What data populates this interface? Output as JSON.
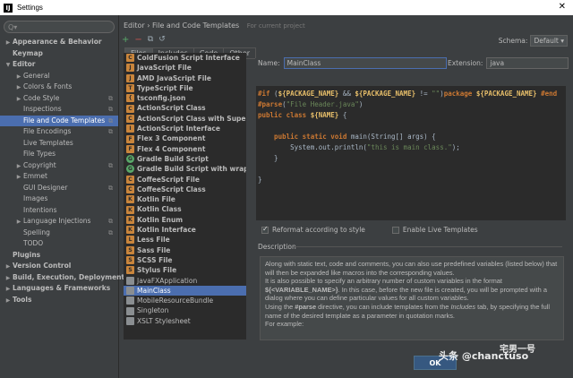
{
  "window": {
    "title": "Settings",
    "app_icon": "intellij-icon",
    "close_glyph": "✕"
  },
  "search": {
    "placeholder": "Q▾"
  },
  "tree": [
    {
      "label": "Appearance & Behavior",
      "bold": true,
      "arrow": "▶",
      "indent": 0
    },
    {
      "label": "Keymap",
      "bold": true,
      "arrow": "",
      "indent": 0
    },
    {
      "label": "Editor",
      "bold": true,
      "arrow": "▼",
      "indent": 0
    },
    {
      "label": "General",
      "bold": false,
      "arrow": "▶",
      "indent": 1
    },
    {
      "label": "Colors & Fonts",
      "bold": false,
      "arrow": "▶",
      "indent": 1
    },
    {
      "label": "Code Style",
      "bold": false,
      "arrow": "▶",
      "indent": 1,
      "cfg": true
    },
    {
      "label": "Inspections",
      "bold": false,
      "arrow": "",
      "indent": 1,
      "cfg": true
    },
    {
      "label": "File and Code Templates",
      "bold": false,
      "arrow": "",
      "indent": 1,
      "cfg": true,
      "selected": true
    },
    {
      "label": "File Encodings",
      "bold": false,
      "arrow": "",
      "indent": 1,
      "cfg": true
    },
    {
      "label": "Live Templates",
      "bold": false,
      "arrow": "",
      "indent": 1
    },
    {
      "label": "File Types",
      "bold": false,
      "arrow": "",
      "indent": 1
    },
    {
      "label": "Copyright",
      "bold": false,
      "arrow": "▶",
      "indent": 1,
      "cfg": true
    },
    {
      "label": "Emmet",
      "bold": false,
      "arrow": "▶",
      "indent": 1
    },
    {
      "label": "GUI Designer",
      "bold": false,
      "arrow": "",
      "indent": 1,
      "cfg": true
    },
    {
      "label": "Images",
      "bold": false,
      "arrow": "",
      "indent": 1
    },
    {
      "label": "Intentions",
      "bold": false,
      "arrow": "",
      "indent": 1
    },
    {
      "label": "Language Injections",
      "bold": false,
      "arrow": "▶",
      "indent": 1,
      "cfg": true
    },
    {
      "label": "Spelling",
      "bold": false,
      "arrow": "",
      "indent": 1,
      "cfg": true
    },
    {
      "label": "TODO",
      "bold": false,
      "arrow": "",
      "indent": 1
    },
    {
      "label": "Plugins",
      "bold": true,
      "arrow": "",
      "indent": 0
    },
    {
      "label": "Version Control",
      "bold": true,
      "arrow": "▶",
      "indent": 0
    },
    {
      "label": "Build, Execution, Deployment",
      "bold": true,
      "arrow": "▶",
      "indent": 0
    },
    {
      "label": "Languages & Frameworks",
      "bold": true,
      "arrow": "▶",
      "indent": 0
    },
    {
      "label": "Tools",
      "bold": true,
      "arrow": "▶",
      "indent": 0
    }
  ],
  "breadcrumb": {
    "section": "Editor",
    "sep": "›",
    "page": "File and Code Templates",
    "note": "For current project"
  },
  "toolbar": {
    "add": "+",
    "remove": "−",
    "copy": "⧉",
    "reset": "↺"
  },
  "schema": {
    "label": "Schema:",
    "value": "Default",
    "chevron": "▾"
  },
  "tabs": [
    {
      "label": "Files",
      "active": true
    },
    {
      "label": "Includes",
      "active": false
    },
    {
      "label": "Code",
      "active": false
    },
    {
      "label": "Other",
      "active": false
    }
  ],
  "files": [
    {
      "label": "ColdFusion Script Interface",
      "bold": true,
      "icon": "orange",
      "glyph": "C"
    },
    {
      "label": "JavaScript File",
      "bold": true,
      "icon": "orange",
      "glyph": "J"
    },
    {
      "label": "AMD JavaScript File",
      "bold": true,
      "icon": "orange",
      "glyph": "J"
    },
    {
      "label": "TypeScript File",
      "bold": true,
      "icon": "orange",
      "glyph": "T"
    },
    {
      "label": "tsconfig.json",
      "bold": true,
      "icon": "orange",
      "glyph": "{"
    },
    {
      "label": "ActionScript Class",
      "bold": true,
      "icon": "orange",
      "glyph": "C"
    },
    {
      "label": "ActionScript Class with Supers",
      "bold": true,
      "icon": "orange",
      "glyph": "C"
    },
    {
      "label": "ActionScript Interface",
      "bold": true,
      "icon": "orange",
      "glyph": "I"
    },
    {
      "label": "Flex 3 Component",
      "bold": true,
      "icon": "orange",
      "glyph": "F"
    },
    {
      "label": "Flex 4 Component",
      "bold": true,
      "icon": "orange",
      "glyph": "F"
    },
    {
      "label": "Gradle Build Script",
      "bold": true,
      "icon": "green",
      "glyph": "G"
    },
    {
      "label": "Gradle Build Script with wrapper",
      "bold": true,
      "icon": "green",
      "glyph": "G"
    },
    {
      "label": "CoffeeScript File",
      "bold": true,
      "icon": "orange",
      "glyph": "C"
    },
    {
      "label": "CoffeeScript Class",
      "bold": true,
      "icon": "orange",
      "glyph": "C"
    },
    {
      "label": "Kotlin File",
      "bold": true,
      "icon": "orange",
      "glyph": "K"
    },
    {
      "label": "Kotlin Class",
      "bold": true,
      "icon": "orange",
      "glyph": "K"
    },
    {
      "label": "Kotlin Enum",
      "bold": true,
      "icon": "orange",
      "glyph": "K"
    },
    {
      "label": "Kotlin Interface",
      "bold": true,
      "icon": "orange",
      "glyph": "K"
    },
    {
      "label": "Less File",
      "bold": true,
      "icon": "orange",
      "glyph": "L"
    },
    {
      "label": "Sass File",
      "bold": true,
      "icon": "orange",
      "glyph": "S"
    },
    {
      "label": "SCSS File",
      "bold": true,
      "icon": "orange",
      "glyph": "S"
    },
    {
      "label": "Stylus File",
      "bold": true,
      "icon": "orange",
      "glyph": "S"
    },
    {
      "label": "JavaFXApplication",
      "bold": false,
      "icon": "gray",
      "glyph": ""
    },
    {
      "label": "MainClass",
      "bold": false,
      "icon": "gray",
      "glyph": "",
      "selected": true
    },
    {
      "label": "MobileResourceBundle",
      "bold": false,
      "icon": "gray",
      "glyph": ""
    },
    {
      "label": "Singleton",
      "bold": false,
      "icon": "gray",
      "glyph": ""
    },
    {
      "label": "XSLT Stylesheet",
      "bold": false,
      "icon": "gray",
      "glyph": ""
    }
  ],
  "form": {
    "name_label": "Name:",
    "name_value": "MainClass",
    "ext_label": "Extension:",
    "ext_value": "java"
  },
  "editor_lines": [
    [
      [
        "dir",
        "#if"
      ],
      [
        "op",
        " ("
      ],
      [
        "var",
        "${PACKAGE_NAME}"
      ],
      [
        "op",
        " && "
      ],
      [
        "var",
        "${PACKAGE_NAME}"
      ],
      [
        "op",
        " != "
      ],
      [
        "str",
        "\"\""
      ],
      [
        "op",
        ")"
      ],
      [
        "kw",
        "package "
      ],
      [
        "var",
        "${PACKAGE_NAME}"
      ],
      [
        "op",
        " "
      ],
      [
        "dir",
        "#end"
      ]
    ],
    [
      [
        "dir",
        "#parse"
      ],
      [
        "op",
        "("
      ],
      [
        "str",
        "\"File Header.java\""
      ],
      [
        "op",
        ")"
      ]
    ],
    [
      [
        "kw",
        "public class "
      ],
      [
        "var",
        "${NAME}"
      ],
      [
        "op",
        " {"
      ]
    ],
    [
      [
        "op",
        ""
      ]
    ],
    [
      [
        "kw",
        "    public static void "
      ],
      [
        "op",
        "main(String[] args) {"
      ]
    ],
    [
      [
        "op",
        "        System.out.println("
      ],
      [
        "str",
        "\"this is main class.\""
      ],
      [
        "op",
        ");"
      ]
    ],
    [
      [
        "op",
        "    }"
      ]
    ],
    [
      [
        "op",
        ""
      ]
    ],
    [
      [
        "op",
        "}"
      ]
    ]
  ],
  "options": {
    "reformat_label": "Reformat according to style",
    "reformat_checked": true,
    "live_label": "Enable Live Templates",
    "live_checked": false
  },
  "description": {
    "label": "Description",
    "p1": "Along with static text, code and comments, you can also use predefined variables (listed below) that will then be expanded like macros into the corresponding values.",
    "p2a": "It is also possible to specify an arbitrary number of custom variables in the format ",
    "p2b": "${<VARIABLE_NAME>}",
    "p2c": ". In this case, before the new file is created, you will be prompted with a dialog where you can define particular values for all custom variables.",
    "p3a": "Using the ",
    "p3b": "#parse",
    "p3c": " directive, you can include templates from the ",
    "p3d": "Includes",
    "p3e": " tab, by specifying the full name of the desired template as a parameter in quotation marks.",
    "p4": "For example:"
  },
  "buttons": {
    "ok": "OK"
  },
  "watermark": {
    "text": "头条 @chanctuso",
    "text2": "宅男一号"
  }
}
